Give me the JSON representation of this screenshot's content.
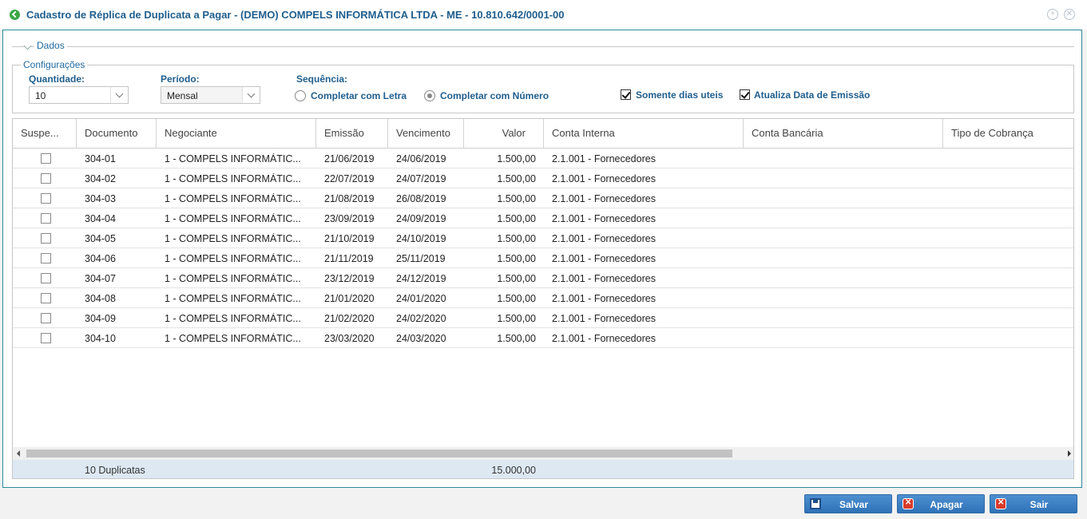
{
  "window": {
    "title": "Cadastro de Réplica de Duplicata a Pagar - (DEMO) COMPELS INFORMÁTICA LTDA - ME - 10.810.642/0001-00",
    "expand_icon": "+",
    "close_icon": "✕"
  },
  "section": {
    "title": "Dados"
  },
  "config": {
    "legend": "Configurações",
    "quantidade_label": "Quantidade:",
    "quantidade_value": "10",
    "periodo_label": "Período:",
    "periodo_value": "Mensal",
    "sequencia_label": "Sequência:",
    "radio_letra": "Completar com Letra",
    "radio_numero": "Completar com Número",
    "radio_selected": "numero",
    "check_dias_uteis": "Somente dias uteis",
    "check_dias_uteis_checked": true,
    "check_atualiza": "Atualiza Data de Emissão",
    "check_atualiza_checked": true
  },
  "table": {
    "columns": [
      "Suspe...",
      "Documento",
      "Negociante",
      "Emissão",
      "Vencimento",
      "Valor",
      "Conta Interna",
      "Conta Bancária",
      "Tipo de Cobrança"
    ],
    "rows": [
      {
        "documento": "304-01",
        "negociante": "1 - COMPELS INFORMÁTIC...",
        "emissao": "21/06/2019",
        "vencimento": "24/06/2019",
        "valor": "1.500,00",
        "conta_interna": "2.1.001 - Fornecedores"
      },
      {
        "documento": "304-02",
        "negociante": "1 - COMPELS INFORMÁTIC...",
        "emissao": "22/07/2019",
        "vencimento": "24/07/2019",
        "valor": "1.500,00",
        "conta_interna": "2.1.001 - Fornecedores"
      },
      {
        "documento": "304-03",
        "negociante": "1 - COMPELS INFORMÁTIC...",
        "emissao": "21/08/2019",
        "vencimento": "26/08/2019",
        "valor": "1.500,00",
        "conta_interna": "2.1.001 - Fornecedores"
      },
      {
        "documento": "304-04",
        "negociante": "1 - COMPELS INFORMÁTIC...",
        "emissao": "23/09/2019",
        "vencimento": "24/09/2019",
        "valor": "1.500,00",
        "conta_interna": "2.1.001 - Fornecedores"
      },
      {
        "documento": "304-05",
        "negociante": "1 - COMPELS INFORMÁTIC...",
        "emissao": "21/10/2019",
        "vencimento": "24/10/2019",
        "valor": "1.500,00",
        "conta_interna": "2.1.001 - Fornecedores"
      },
      {
        "documento": "304-06",
        "negociante": "1 - COMPELS INFORMÁTIC...",
        "emissao": "21/11/2019",
        "vencimento": "25/11/2019",
        "valor": "1.500,00",
        "conta_interna": "2.1.001 - Fornecedores"
      },
      {
        "documento": "304-07",
        "negociante": "1 - COMPELS INFORMÁTIC...",
        "emissao": "23/12/2019",
        "vencimento": "24/12/2019",
        "valor": "1.500,00",
        "conta_interna": "2.1.001 - Fornecedores"
      },
      {
        "documento": "304-08",
        "negociante": "1 - COMPELS INFORMÁTIC...",
        "emissao": "21/01/2020",
        "vencimento": "24/01/2020",
        "valor": "1.500,00",
        "conta_interna": "2.1.001 - Fornecedores"
      },
      {
        "documento": "304-09",
        "negociante": "1 - COMPELS INFORMÁTIC...",
        "emissao": "21/02/2020",
        "vencimento": "24/02/2020",
        "valor": "1.500,00",
        "conta_interna": "2.1.001 - Fornecedores"
      },
      {
        "documento": "304-10",
        "negociante": "1 - COMPELS INFORMÁTIC...",
        "emissao": "23/03/2020",
        "vencimento": "24/03/2020",
        "valor": "1.500,00",
        "conta_interna": "2.1.001 - Fornecedores"
      }
    ],
    "footer": {
      "count": "10 Duplicatas",
      "total": "15.000,00"
    }
  },
  "buttons": {
    "save": "Salvar",
    "delete": "Apagar",
    "exit": "Sair"
  }
}
